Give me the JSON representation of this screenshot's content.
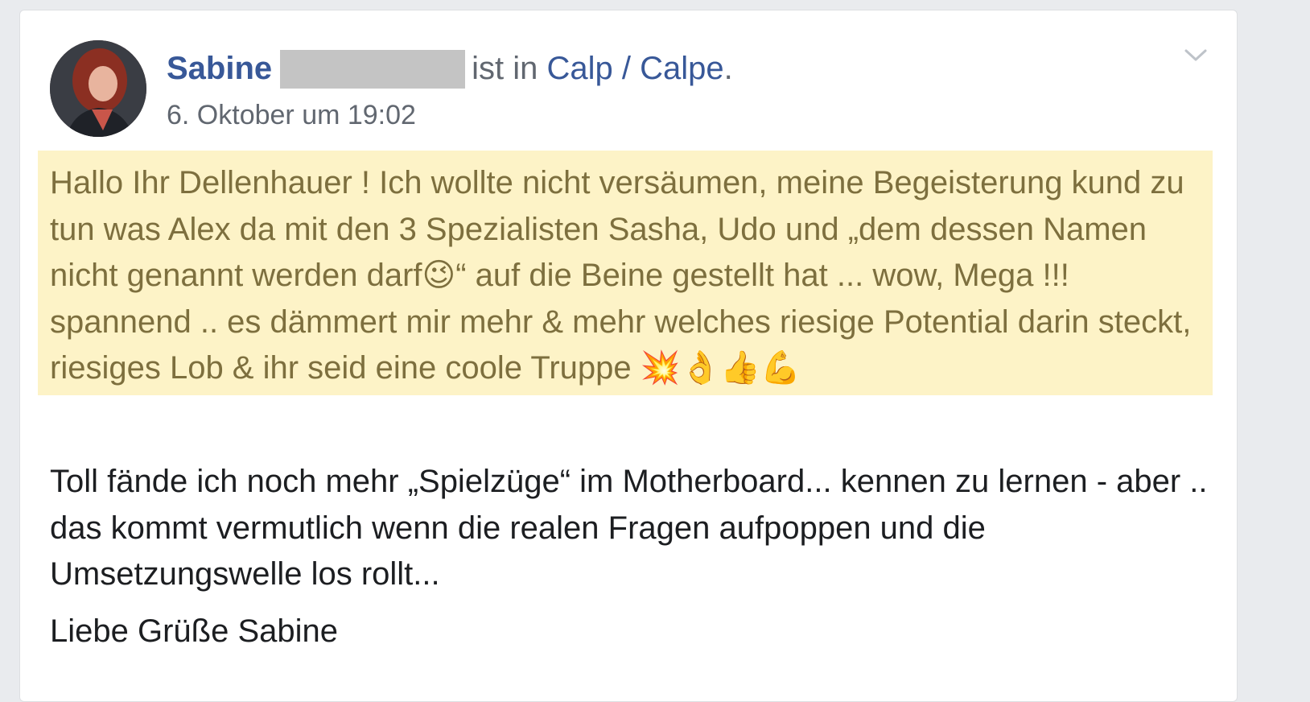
{
  "post": {
    "author": "Sabine",
    "location_text": "ist in",
    "location": "Calp / Calpe",
    "location_suffix": ".",
    "timestamp": "6. Oktober um 19:02",
    "paragraphs": [
      "Hallo Ihr Dellenhauer ! Ich wollte nicht versäumen, meine Begeisterung kund zu tun was Alex da mit den 3 Spezialisten Sasha, Udo und „dem dessen Namen nicht genannt werden darf😉“ auf die Beine gestellt hat ... wow, Mega !!! spannend .. es dämmert mir mehr & mehr welches riesige Potential darin steckt, riesiges Lob & ihr seid eine coole Truppe 💥👌👍💪",
      "Toll fände ich noch mehr „Spielzüge“ im Motherboard... kennen zu lernen - aber .. das kommt vermutlich wenn die realen Fragen aufpoppen und die Umsetzungswelle los rollt...",
      "Liebe Grüße Sabine"
    ],
    "menu_icon": "chevron-down-icon",
    "colors": {
      "link": "#385898",
      "highlight_bg": "#fdf3c7",
      "highlight_text": "#7d6f3e",
      "body_text": "#1c1e21",
      "meta_text": "#616770"
    }
  }
}
